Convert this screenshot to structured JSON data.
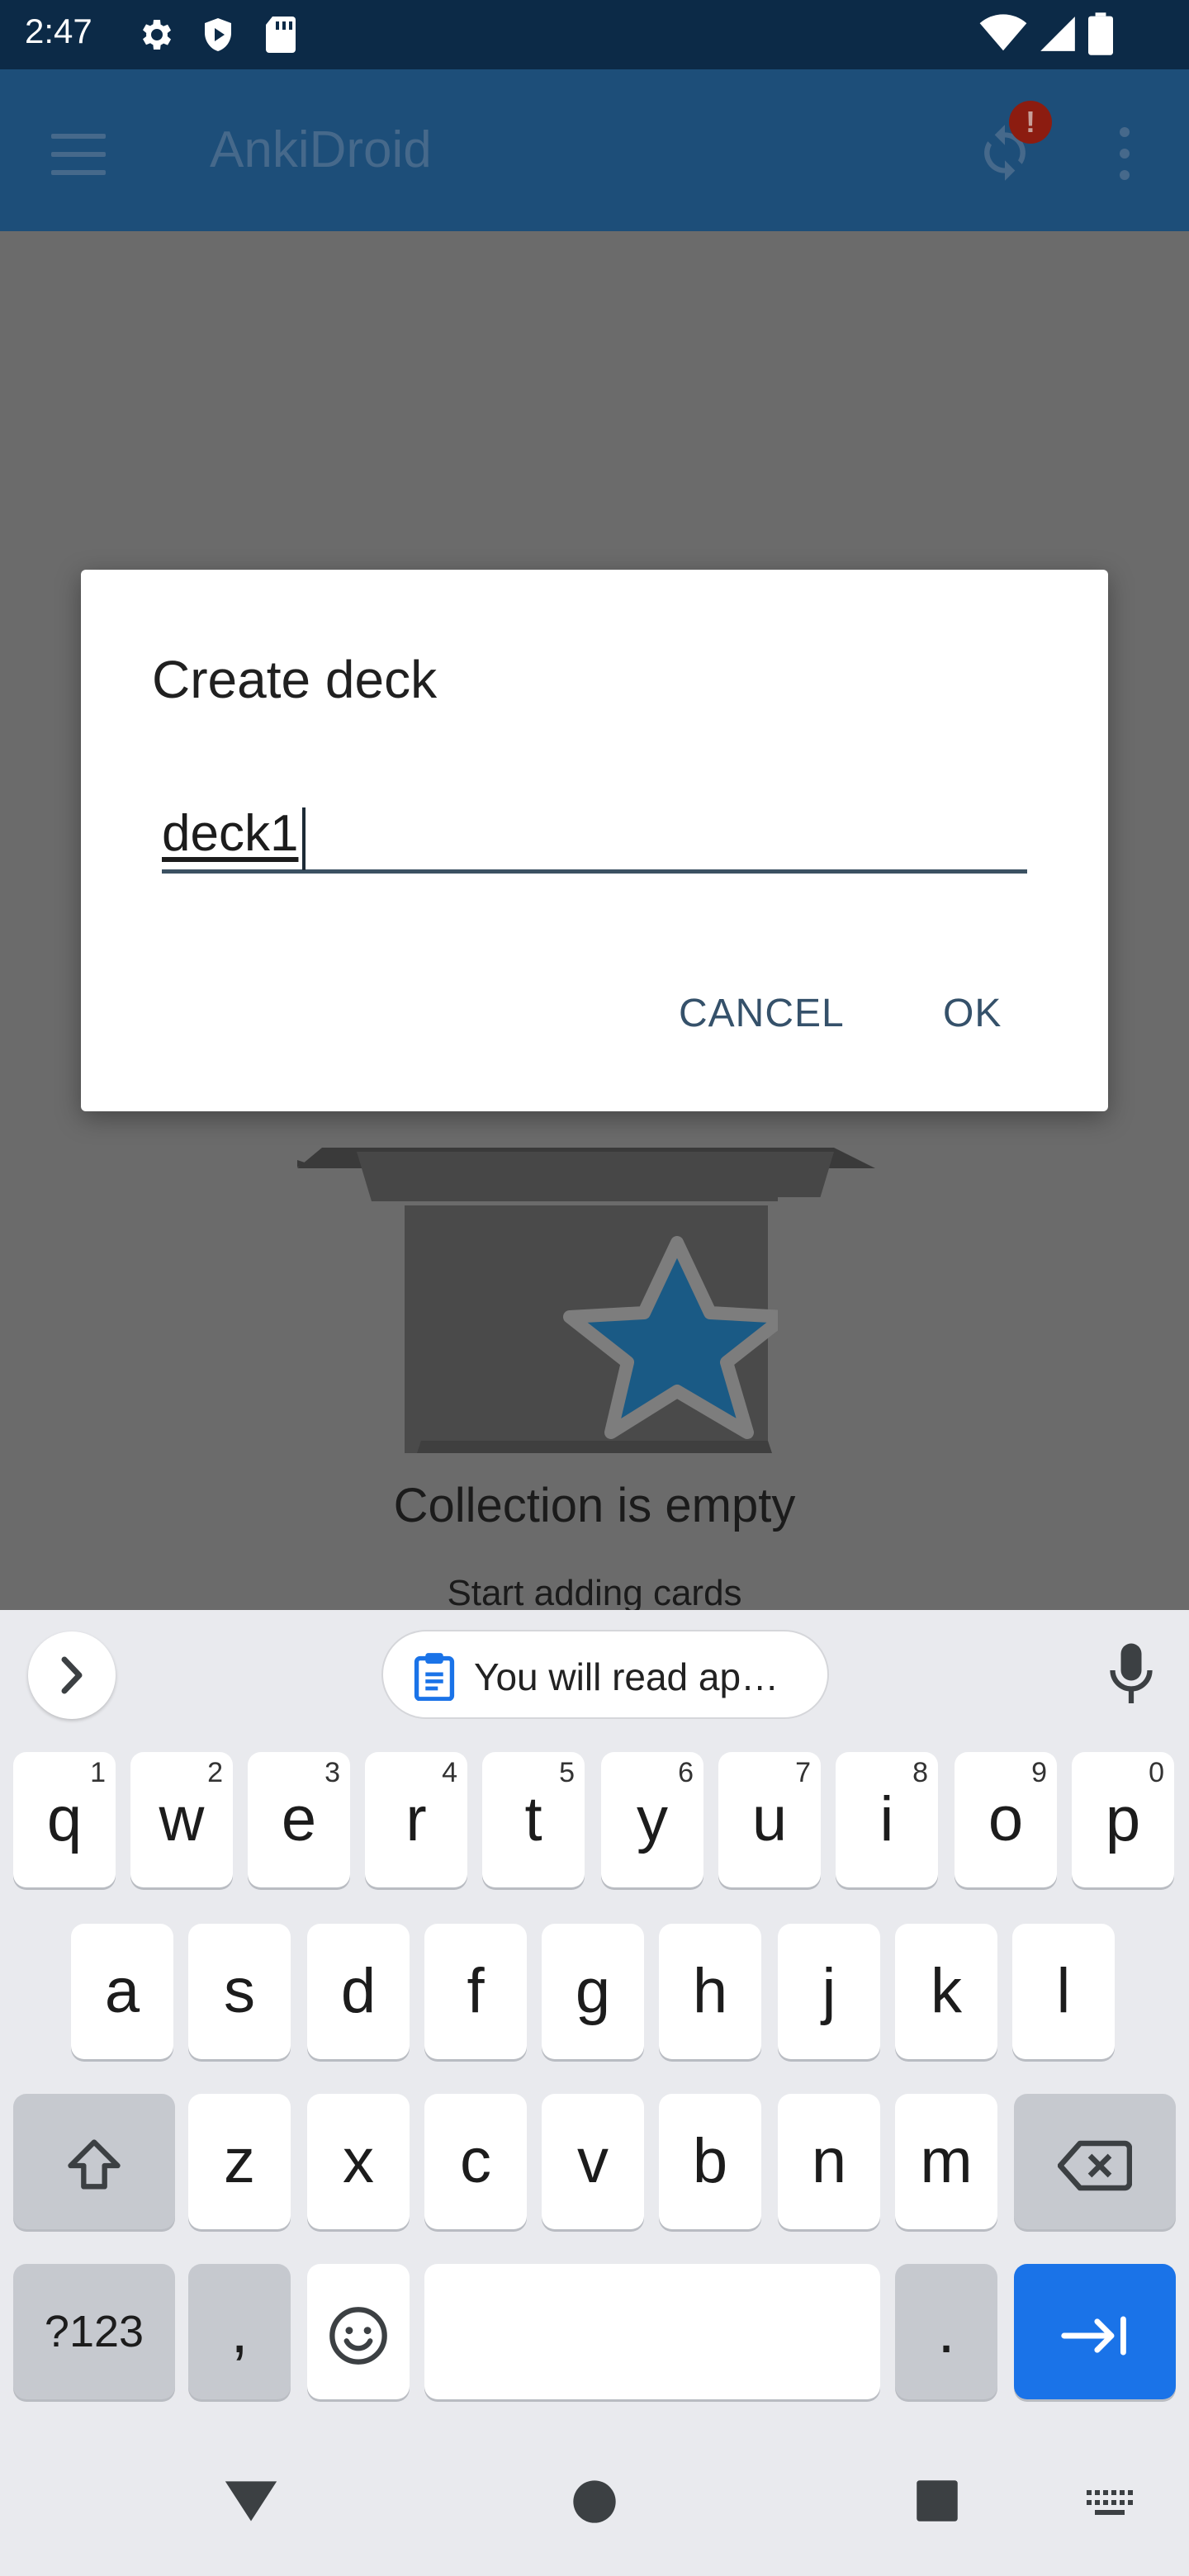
{
  "status_bar": {
    "time": "2:47"
  },
  "app_bar": {
    "title": "AnkiDroid",
    "sync_badge": "!"
  },
  "content": {
    "empty_title": "Collection is empty",
    "empty_subtitle": "Start adding cards"
  },
  "dialog": {
    "title": "Create deck",
    "input_value": "deck1",
    "cancel_label": "CANCEL",
    "ok_label": "OK"
  },
  "keyboard": {
    "clipboard_suggestion": "You will read ap…",
    "row1": [
      {
        "label": "q",
        "hint": "1"
      },
      {
        "label": "w",
        "hint": "2"
      },
      {
        "label": "e",
        "hint": "3"
      },
      {
        "label": "r",
        "hint": "4"
      },
      {
        "label": "t",
        "hint": "5"
      },
      {
        "label": "y",
        "hint": "6"
      },
      {
        "label": "u",
        "hint": "7"
      },
      {
        "label": "i",
        "hint": "8"
      },
      {
        "label": "o",
        "hint": "9"
      },
      {
        "label": "p",
        "hint": "0"
      }
    ],
    "row2": [
      "a",
      "s",
      "d",
      "f",
      "g",
      "h",
      "j",
      "k",
      "l"
    ],
    "row3": [
      "z",
      "x",
      "c",
      "v",
      "b",
      "n",
      "m"
    ],
    "symbols_label": "?123",
    "comma_label": ",",
    "period_label": "."
  },
  "colors": {
    "status_bar": "#0c2a47",
    "app_bar_dimmed": "#1d4e79",
    "scrim_background": "#6b6b6b",
    "accent_button": "#35516a",
    "enter_key": "#1a73e8"
  }
}
